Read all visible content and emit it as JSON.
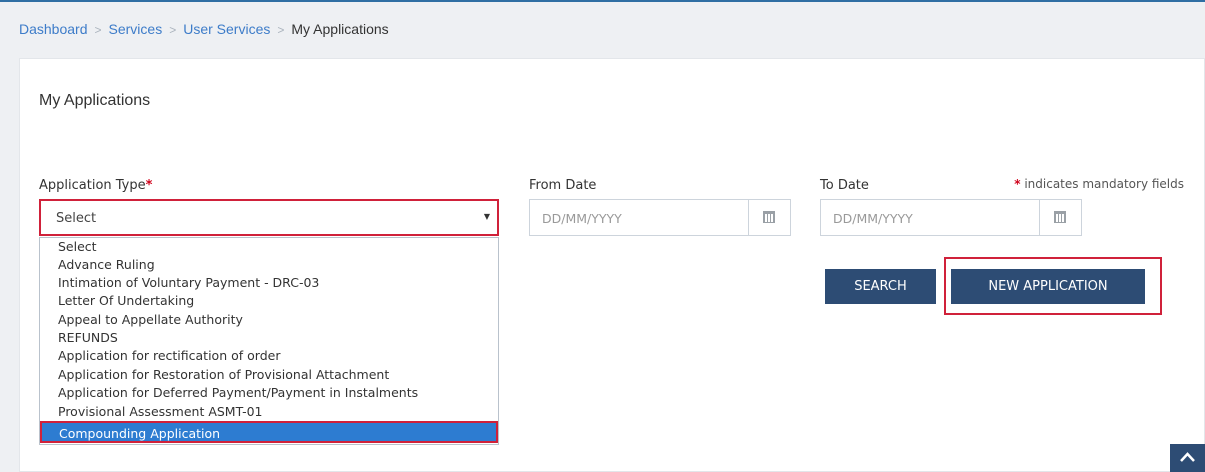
{
  "breadcrumb": {
    "items": [
      "Dashboard",
      "Services",
      "User Services"
    ],
    "current": "My Applications",
    "separator": ">"
  },
  "page": {
    "title": "My Applications",
    "mandatory_note": "indicates mandatory fields",
    "required_marker": "*"
  },
  "form": {
    "application_type_label": "Application Type",
    "application_type_value": "Select",
    "from_date_label": "From Date",
    "from_date_placeholder": "DD/MM/YYYY",
    "to_date_label": "To Date",
    "to_date_placeholder": "DD/MM/YYYY"
  },
  "dropdown": {
    "options": [
      "Select",
      "Advance Ruling",
      "Intimation of Voluntary Payment - DRC-03",
      "Letter Of Undertaking",
      "Appeal to Appellate Authority",
      "REFUNDS",
      "Application for rectification of order",
      "Application for Restoration of Provisional Attachment",
      "Application for Deferred Payment/Payment in Instalments",
      "Provisional Assessment ASMT-01",
      "Compounding Application"
    ],
    "highlighted_index": 10
  },
  "buttons": {
    "search": "SEARCH",
    "new_application": "NEW APPLICATION"
  },
  "icons": {
    "calendar": "calendar-icon",
    "caret": "caret-down-icon",
    "scroll_top": "chevron-up-icon"
  },
  "colors": {
    "primary_button": "#2d4c74",
    "highlight_border": "#d0213a",
    "selected_option": "#2d7cd1",
    "link": "#3d7cc9"
  }
}
